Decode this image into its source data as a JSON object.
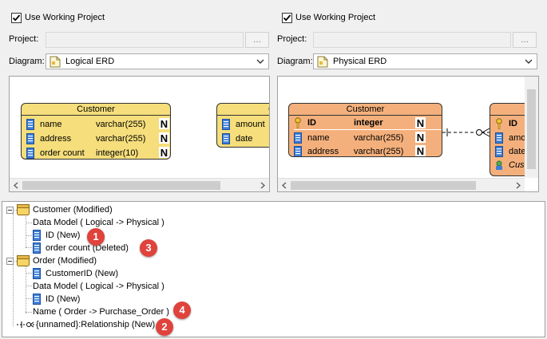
{
  "left_panel": {
    "use_working_project": {
      "label": "Use Working Project",
      "checked": true
    },
    "project_label": "Project:",
    "project_value": "",
    "browse_label": "...",
    "diagram_label": "Diagram:",
    "diagram_value": "Logical ERD",
    "entities": [
      {
        "name": "Customer",
        "columns": [
          {
            "name": "name",
            "type": "varchar(255)",
            "null": "N"
          },
          {
            "name": "address",
            "type": "varchar(255)",
            "null": "N"
          },
          {
            "name": "order count",
            "type": "integer(10)",
            "null": "N"
          }
        ]
      },
      {
        "name": "O",
        "columns": [
          {
            "name": "amount"
          },
          {
            "name": "date"
          }
        ]
      }
    ]
  },
  "right_panel": {
    "use_working_project": {
      "label": "Use Working Project",
      "checked": true
    },
    "project_label": "Project:",
    "project_value": "",
    "browse_label": "...",
    "diagram_label": "Diagram:",
    "diagram_value": "Physical ERD",
    "entities": [
      {
        "name": "Customer",
        "columns": [
          {
            "name": "ID",
            "type": "integer",
            "null": "N",
            "pk": true
          },
          {
            "name": "name",
            "type": "varchar(255)",
            "null": "N"
          },
          {
            "name": "address",
            "type": "varchar(255)",
            "null": "N"
          }
        ]
      },
      {
        "name": "",
        "columns": [
          {
            "name": "ID",
            "pk": true
          },
          {
            "name": "amo"
          },
          {
            "name": "date"
          },
          {
            "name": "Cus"
          }
        ]
      }
    ]
  },
  "tree": {
    "nodes": [
      {
        "label": "Customer (Modified)",
        "icon": "entity-icon"
      },
      {
        "label": "Data Model ( Logical -> Physical )"
      },
      {
        "label": "ID (New)",
        "icon": "column-icon"
      },
      {
        "label": "order count (Deleted)",
        "icon": "column-icon"
      },
      {
        "label": "Order (Modified)",
        "icon": "entity-icon"
      },
      {
        "label": "CustomerID (New)",
        "icon": "column-icon"
      },
      {
        "label": "Data Model ( Logical -> Physical )"
      },
      {
        "label": "ID (New)",
        "icon": "column-icon"
      },
      {
        "label": "Name ( Order -> Purchase_Order )"
      },
      {
        "label": "{unnamed}:Relationship (New)",
        "icon": "relationship-icon"
      }
    ],
    "badges": [
      "1",
      "3",
      "4",
      "2"
    ]
  },
  "colors": {
    "logical_entity": "#f5de7b",
    "physical_entity": "#f4b07c",
    "badge": "#e0423c"
  }
}
